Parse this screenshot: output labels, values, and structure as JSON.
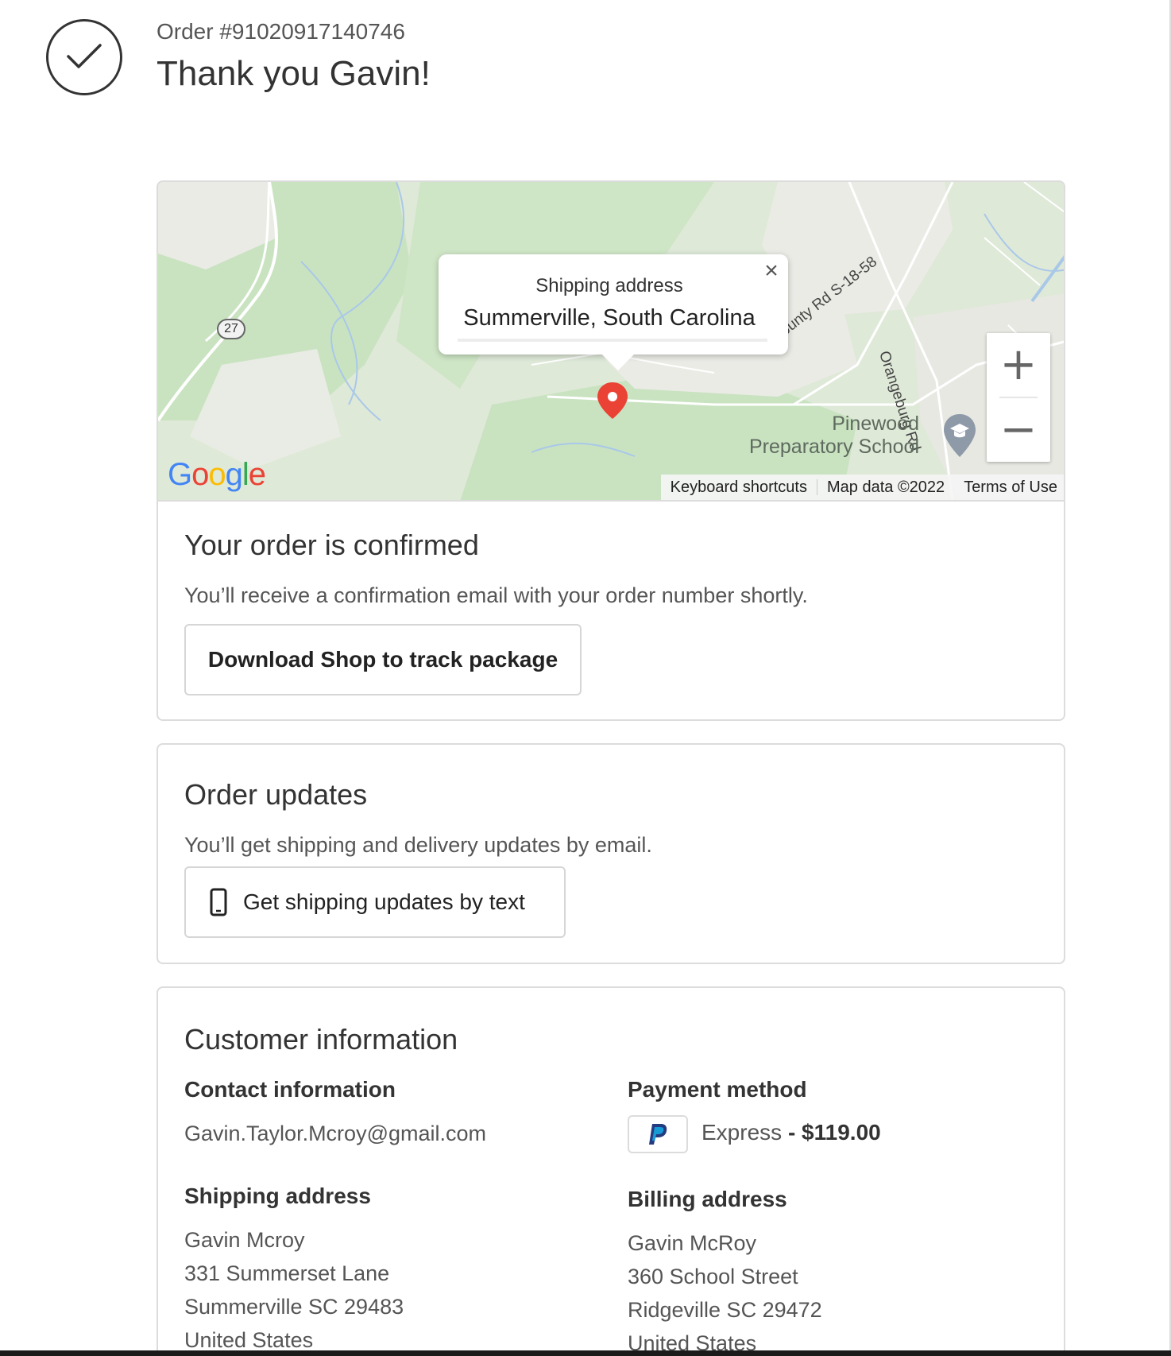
{
  "header": {
    "order_number": "Order #91020917140746",
    "thank_you": "Thank you Gavin!"
  },
  "map": {
    "popup_title": "Shipping address",
    "popup_city": "Summerville, South Carolina",
    "close_glyph": "×",
    "zoom_in": "+",
    "zoom_out": "−",
    "poi_line1": "Pinewood",
    "poi_line2": "Preparatory School",
    "road_county": "County Rd S-18-58",
    "road_orangeburg": "Orangeburg Rd",
    "route_shield": "27",
    "google_logo": "Google",
    "footer": {
      "keyboard": "Keyboard shortcuts",
      "map_data": "Map data ©2022",
      "terms": "Terms of Use"
    },
    "colors": {
      "land": "#dfe9d8",
      "forest": "#c9e3c1",
      "urban": "#ebebe6",
      "water": "#a9c8e8",
      "pin": "#ea4335"
    },
    "icons": [
      "map-pin-icon",
      "school-icon",
      "close-icon"
    ]
  },
  "confirmation": {
    "title": "Your order is confirmed",
    "text": "You’ll receive a confirmation email with your order number shortly.",
    "button": "Download Shop to track package"
  },
  "updates": {
    "title": "Order updates",
    "text": "You’ll get shipping and delivery updates by email.",
    "button": "Get shipping updates by text",
    "button_icon": "phone-icon"
  },
  "customer": {
    "title": "Customer information",
    "contact_heading": "Contact information",
    "email": "Gavin.Taylor.Mcroy@gmail.com",
    "payment_heading": "Payment method",
    "payment_method": "Express",
    "payment_amount": "- $119.00",
    "payment_icon": "paypal-icon",
    "shipping_heading": "Shipping address",
    "shipping": [
      "Gavin Mcroy",
      "331 Summerset Lane",
      "Summerville SC 29483",
      "United States"
    ],
    "billing_heading": "Billing address",
    "billing": [
      "Gavin McRoy",
      "360 School Street",
      "Ridgeville SC 29472",
      "United States"
    ]
  }
}
